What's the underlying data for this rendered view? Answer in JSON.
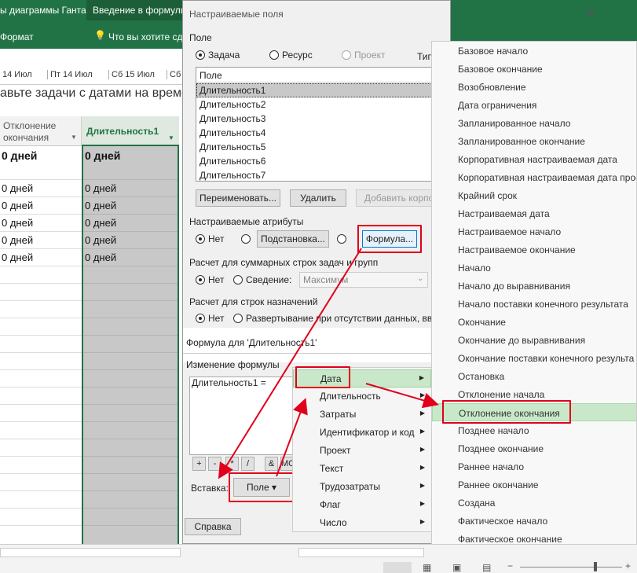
{
  "ribbon": {
    "tabs": [
      "ы диаграммы Ганта",
      "Введение в формулы"
    ],
    "row2": [
      "Формат",
      "Что вы хотите сде"
    ]
  },
  "timescale": [
    "14 Июл",
    "Пт 14 Июл",
    "Сб 15 Июл",
    "Сб"
  ],
  "hint": "авьте задачи с датами на време",
  "grid": {
    "col1_header": "Отклонение окончания",
    "col2_header": "Длительность1",
    "summary_value": "0 дней",
    "rows": [
      "0 дней",
      "0 дней",
      "0 дней",
      "0 дней",
      "0 дней"
    ]
  },
  "dialog": {
    "title": "Настраиваемые поля",
    "field_label": "Поле",
    "radio_task": "Задача",
    "radio_resource": "Ресурс",
    "radio_project": "Проект",
    "type_label": "Тип",
    "list_header": "Поле",
    "fields": [
      "Длительность1",
      "Длительность2",
      "Длительность3",
      "Длительность4",
      "Длительность5",
      "Длительность6",
      "Длительность7"
    ],
    "rename_btn": "Переименовать...",
    "delete_btn": "Удалить",
    "add_btn": "Добавить корпо",
    "custom_attrs_label": "Настраиваемые атрибуты",
    "attr_none": "Нет",
    "lookup_btn": "Подстановка...",
    "formula_btn": "Формула...",
    "summary_label": "Расчет для суммарных строк задач и групп",
    "summary_none": "Нет",
    "summary_rollup": "Сведение:",
    "summary_combo": "Максимум",
    "assign_label": "Расчет для строк назначений",
    "assign_none": "Нет",
    "assign_rollout": "Развертывание при отсутствии данных, введ",
    "formula_for": "Формула для 'Длительность1'",
    "edit_formula_label": "Изменение формулы",
    "formula_text": "Длительность1 =",
    "op_buttons": [
      "+",
      "-",
      "*",
      "/",
      "&",
      "MO"
    ],
    "insert_label": "Вставка:",
    "field_btn": "Поле",
    "help_btn": "Справка"
  },
  "menu1": [
    "Дата",
    "Длительность",
    "Затраты",
    "Идентификатор и код",
    "Проект",
    "Текст",
    "Трудозатраты",
    "Флаг",
    "Число"
  ],
  "menu2": [
    "Базовое начало",
    "Базовое окончание",
    "Возобновление",
    "Дата ограничения",
    "Запланированное начало",
    "Запланированное окончание",
    "Корпоративная настраиваемая дата",
    "Корпоративная настраиваемая дата прое",
    "Крайний срок",
    "Настраиваемая дата",
    "Настраиваемое начало",
    "Настраиваемое окончание",
    "Начало",
    "Начало до выравнивания",
    "Начало поставки конечного результата",
    "Окончание",
    "Окончание до выравнивания",
    "Окончание поставки конечного результа",
    "Остановка",
    "Отклонение начала",
    "Отклонение окончания",
    "Позднее начало",
    "Позднее окончание",
    "Раннее начало",
    "Раннее окончание",
    "Создана",
    "Фактическое начало",
    "Фактическое окончание"
  ],
  "colors": {
    "ribbon": "#217346",
    "highlight": "#c9e8c9",
    "annotation": "#e0001b"
  }
}
